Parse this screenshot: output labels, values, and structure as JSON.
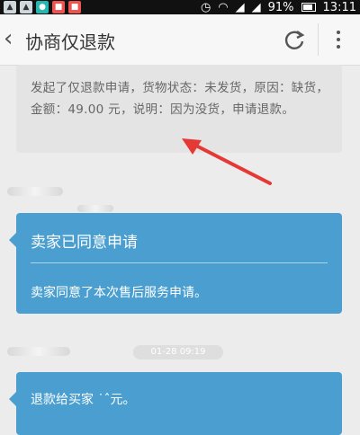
{
  "status_bar": {
    "battery": "91%",
    "time": "13:11",
    "icons": [
      "image-icon",
      "image-icon",
      "teal-app-icon",
      "red-app-icon",
      "red-app-icon",
      "alarm-icon",
      "wifi-icon",
      "signal-icon",
      "signal-icon"
    ]
  },
  "header": {
    "title": "协商仅退款",
    "icons": [
      "back-chevron-icon",
      "refresh-icon",
      "more-vertical-icon"
    ]
  },
  "messages": {
    "request_text": "发起了仅退款申请，货物状态：未发货，原因：缺货，金额：49.00 元，说明：因为没货，申请退款。",
    "seller_agreed": {
      "title": "卖家已同意申请",
      "body": "卖家同意了本次售后服务申请。"
    },
    "timestamp": "01-28 09:19",
    "refund": {
      "body": "退款给买家         ˙ˆ元。"
    }
  },
  "colors": {
    "bubble_blue": "#4a9fd0",
    "arrow_red": "#e53935",
    "card_grey": "#e4e4e4"
  }
}
